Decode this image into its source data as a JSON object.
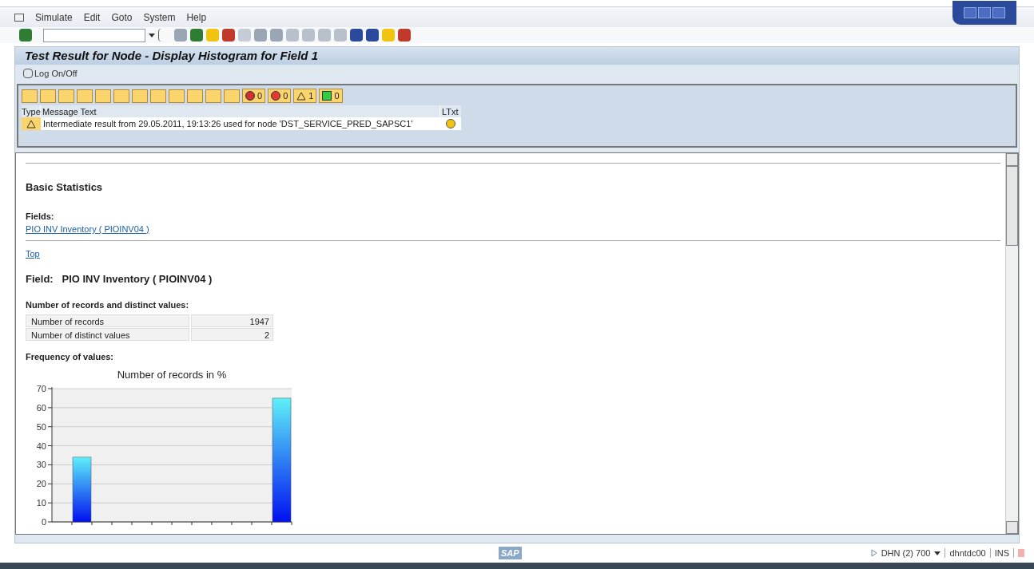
{
  "menu": [
    "Simulate",
    "Edit",
    "Goto",
    "System",
    "Help"
  ],
  "title": "Test Result for Node  - Display Histogram for Field 1",
  "app_toolbar": {
    "button": "Log On/Off"
  },
  "messages": {
    "counters": [
      {
        "kind": "stop",
        "count": "0"
      },
      {
        "kind": "error",
        "count": "0"
      },
      {
        "kind": "warning",
        "count": "1"
      },
      {
        "kind": "ok",
        "count": "0"
      }
    ],
    "columns": [
      "Type",
      "Message Text",
      "LTxt"
    ],
    "rows": [
      {
        "kind": "warning",
        "text": "Intermediate result from 29.05.2011, 19:13:26 used for node 'DST_SERVICE_PRED_SAPSC1'"
      }
    ]
  },
  "report": {
    "heading": "Basic Statistics",
    "fields_label": "Fields:",
    "field_link": "PIO INV Inventory ( PIOINV04 )",
    "top_link": "Top",
    "field_heading": "Field:   PIO INV Inventory ( PIOINV04 )",
    "counts_label": "Number of records and distinct values:",
    "counts": [
      {
        "label": "Number of records",
        "value": "1947"
      },
      {
        "label": "Number of distinct values",
        "value": "2"
      }
    ],
    "frequency_label": "Frequency of values:",
    "chart_data": {
      "type": "bar",
      "title": "Number of records in %",
      "values": [
        null,
        34,
        null,
        null,
        null,
        null,
        null,
        null,
        null,
        null,
        null,
        65
      ],
      "ylim": [
        0,
        70
      ],
      "grid": true,
      "yticks": [
        0,
        10,
        20,
        30,
        40,
        50,
        60,
        70
      ]
    }
  },
  "status_bar": {
    "logo": "SAP",
    "system": "DHN (2) 700",
    "server": "dhntdc00",
    "mode": "INS"
  }
}
